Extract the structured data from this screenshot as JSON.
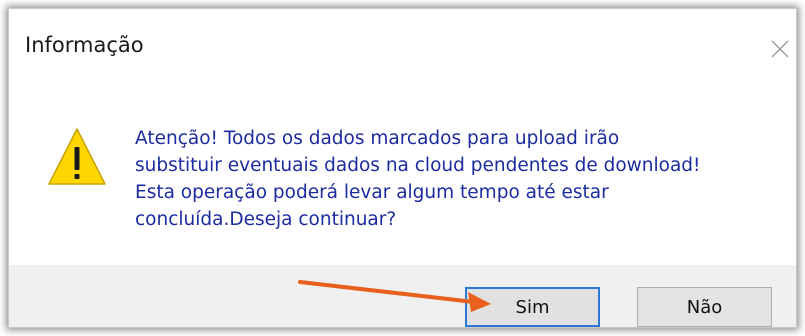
{
  "dialog": {
    "title": "Informação",
    "close_icon": "close-icon",
    "icon": "warning-icon",
    "message_lines": [
      "Atenção! Todos os dados marcados para upload irão",
      "substituir eventuais dados na cloud pendentes de download!",
      "Esta operação poderá levar algum tempo até estar",
      "concluída.Deseja continuar?"
    ],
    "buttons": {
      "yes_label": "Sim",
      "no_label": "Não"
    }
  },
  "annotation": {
    "arrow_icon": "arrow-icon",
    "arrow_color": "#e8601c"
  },
  "colors": {
    "message_text": "#1c2ba0",
    "warning_fill": "#ffd600",
    "primary_border": "#2a77d6",
    "footer_bg": "#f0f0f0"
  }
}
